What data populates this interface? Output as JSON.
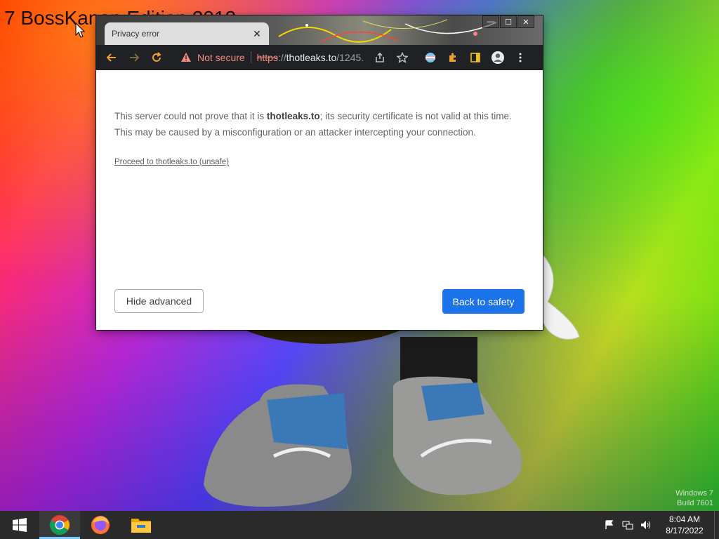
{
  "desktop": {
    "title_text": "7 BossKanon Edition 2012",
    "watermark_line1": "Windows 7",
    "watermark_line2": "Build 7601"
  },
  "browser": {
    "tab_title": "Privacy error",
    "window_controls": [
      "minimize",
      "maximize",
      "close"
    ],
    "omnibox": {
      "security_label": "Not secure",
      "url_scheme": "https",
      "url_separator": "://",
      "url_host": "thotleaks.to",
      "url_path": "/1245..."
    },
    "content": {
      "message_prefix": "This server could not prove that it is ",
      "message_host": "thotleaks.to",
      "message_suffix": "; its security certificate is not valid at this time. This may be caused by a misconfiguration or an attacker intercepting your connection.",
      "proceed_link": "Proceed to thotleaks.to (unsafe)",
      "hide_advanced_label": "Hide advanced",
      "back_to_safety_label": "Back to safety"
    }
  },
  "taskbar": {
    "apps": [
      "chrome-icon",
      "firefox-icon",
      "file-explorer-icon"
    ],
    "clock_time": "8:04 AM",
    "clock_date": "8/17/2022"
  },
  "colors": {
    "accent_blue": "#1a73e8",
    "not_secure_red": "#f28b82",
    "toolbar_dark": "#202124"
  }
}
